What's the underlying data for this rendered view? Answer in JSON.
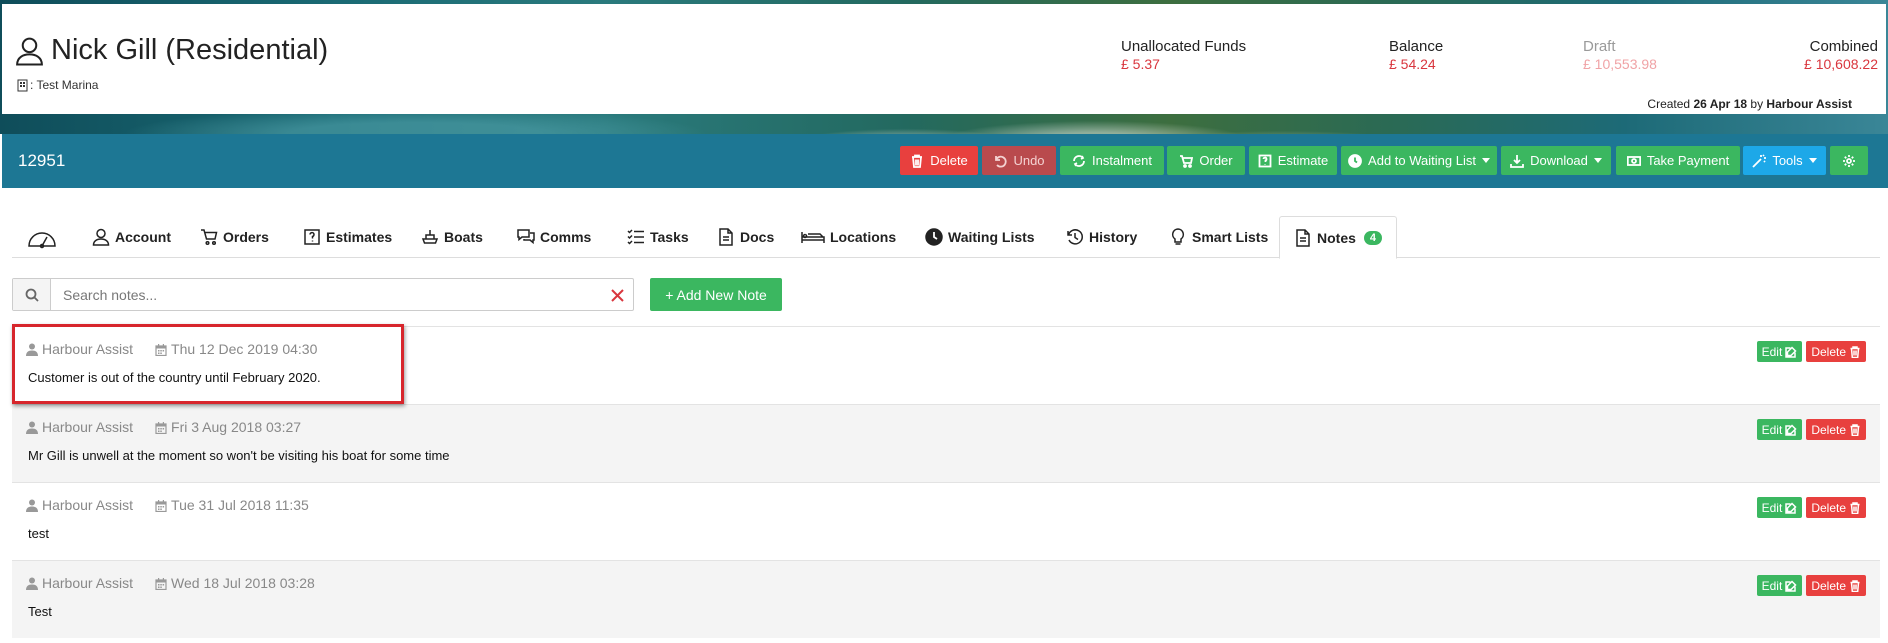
{
  "customer": {
    "name": "Nick Gill (Residential)",
    "marina": ": Test Marina"
  },
  "funds": {
    "unallocated_label": "Unallocated Funds",
    "unallocated_value": "£ 5.37",
    "balance_label": "Balance",
    "balance_value": "£ 54.24",
    "draft_label": "Draft",
    "draft_value": "£ 10,553.98",
    "combined_label": "Combined",
    "combined_value": "£ 10,608.22"
  },
  "created": {
    "prefix": "Created",
    "date": "26 Apr 18",
    "by": "by",
    "author": "Harbour Assist"
  },
  "actionbar": {
    "record_id": "12951",
    "buttons": {
      "delete": "Delete",
      "undo": "Undo",
      "instalment": "Instalment",
      "order": "Order",
      "estimate": "Estimate",
      "waiting_list": "Add to Waiting List",
      "download": "Download",
      "take_payment": "Take Payment",
      "tools": "Tools"
    }
  },
  "tabs": {
    "account": "Account",
    "orders": "Orders",
    "estimates": "Estimates",
    "boats": "Boats",
    "comms": "Comms",
    "tasks": "Tasks",
    "docs": "Docs",
    "locations": "Locations",
    "waiting_lists": "Waiting Lists",
    "history": "History",
    "smart_lists": "Smart Lists",
    "notes": "Notes",
    "notes_count": "4"
  },
  "search": {
    "placeholder": "Search notes...",
    "value": ""
  },
  "add_note_label": "+ Add New Note",
  "note_buttons": {
    "edit": "Edit",
    "delete": "Delete"
  },
  "notes": [
    {
      "author": "Harbour Assist",
      "date": "Thu 12 Dec 2019 04:30",
      "text": "Customer is out of the country until February 2020."
    },
    {
      "author": "Harbour Assist",
      "date": "Fri 3 Aug 2018 03:27",
      "text": "Mr Gill is unwell at the moment so won't be visiting his boat for some time"
    },
    {
      "author": "Harbour Assist",
      "date": "Tue 31 Jul 2018 11:35",
      "text": "test"
    },
    {
      "author": "Harbour Assist",
      "date": "Wed 18 Jul 2018 03:28",
      "text": "Test"
    }
  ],
  "colors": {
    "action_bar": "#1d7794",
    "green": "#3bb760",
    "red": "#e8403e",
    "blue": "#1da8e8",
    "highlight": "#d7262c"
  }
}
